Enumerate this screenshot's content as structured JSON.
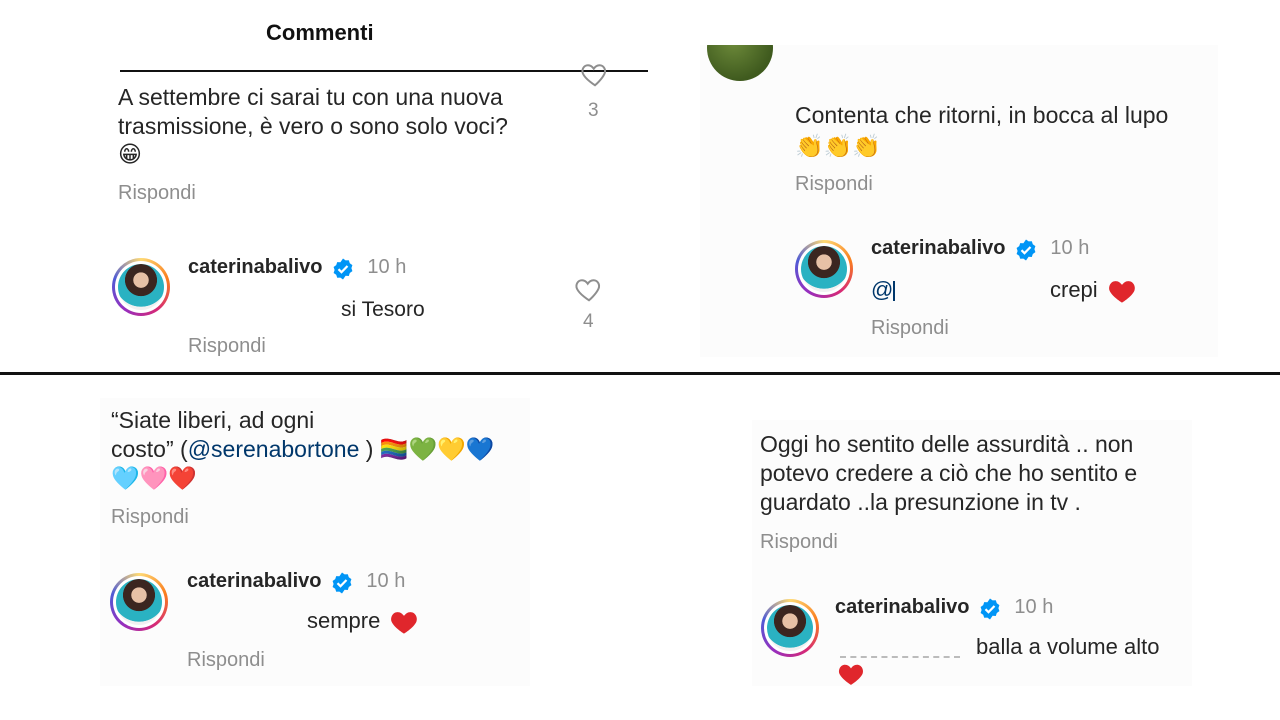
{
  "header": {
    "title": "Commenti"
  },
  "panel1": {
    "comment_line1": "A settembre ci sarai tu con una nuova",
    "comment_line2": "trasmissione, è vero o sono solo voci?",
    "emoji": "😁",
    "like_count": "3",
    "reply_label": "Rispondi",
    "reply_user": "caterinabalivo",
    "reply_time": "10 h",
    "reply_text": "si Tesoro",
    "reply_like_count": "4",
    "reply_reply_label": "Rispondi"
  },
  "panel2": {
    "comment_line1": "Contenta che ritorni, in bocca al lupo",
    "emoji": "👏👏👏",
    "reply_label": "Rispondi",
    "reply_user": "caterinabalivo",
    "reply_time": "10 h",
    "mention_prefix": "@",
    "reply_text": "crepi",
    "reply_reply_label": "Rispondi"
  },
  "panel3": {
    "comment_line1": "“Siate liberi, ad ogni",
    "comment_line2_pre": "costo” (",
    "mention": "@serenabortone",
    "comment_line2_post": " )",
    "emoji_line2": "🏳️‍🌈💚💛💙",
    "emoji_line3": "🩵🩷❤️",
    "reply_label": "Rispondi",
    "reply_user": "caterinabalivo",
    "reply_time": "10 h",
    "reply_text": "sempre",
    "reply_reply_label": "Rispondi"
  },
  "panel4": {
    "comment_line1": "Oggi ho sentito delle assurdità .. non",
    "comment_line2": "potevo credere a ciò che ho sentito e",
    "comment_line3": "guardato ..la presunzione in tv .",
    "reply_label": "Rispondi",
    "reply_user": "caterinabalivo",
    "reply_time": "10 h",
    "reply_text": "balla a volume alto"
  },
  "colors": {
    "text": "#262626",
    "secondary": "#8e8e8e",
    "mention": "#00376b",
    "verified": "#0095f6",
    "heart": "#ed4956"
  },
  "icons": [
    "heart-outline-icon",
    "verified-badge-icon",
    "heart-emoji-icon",
    "avatar-image"
  ]
}
